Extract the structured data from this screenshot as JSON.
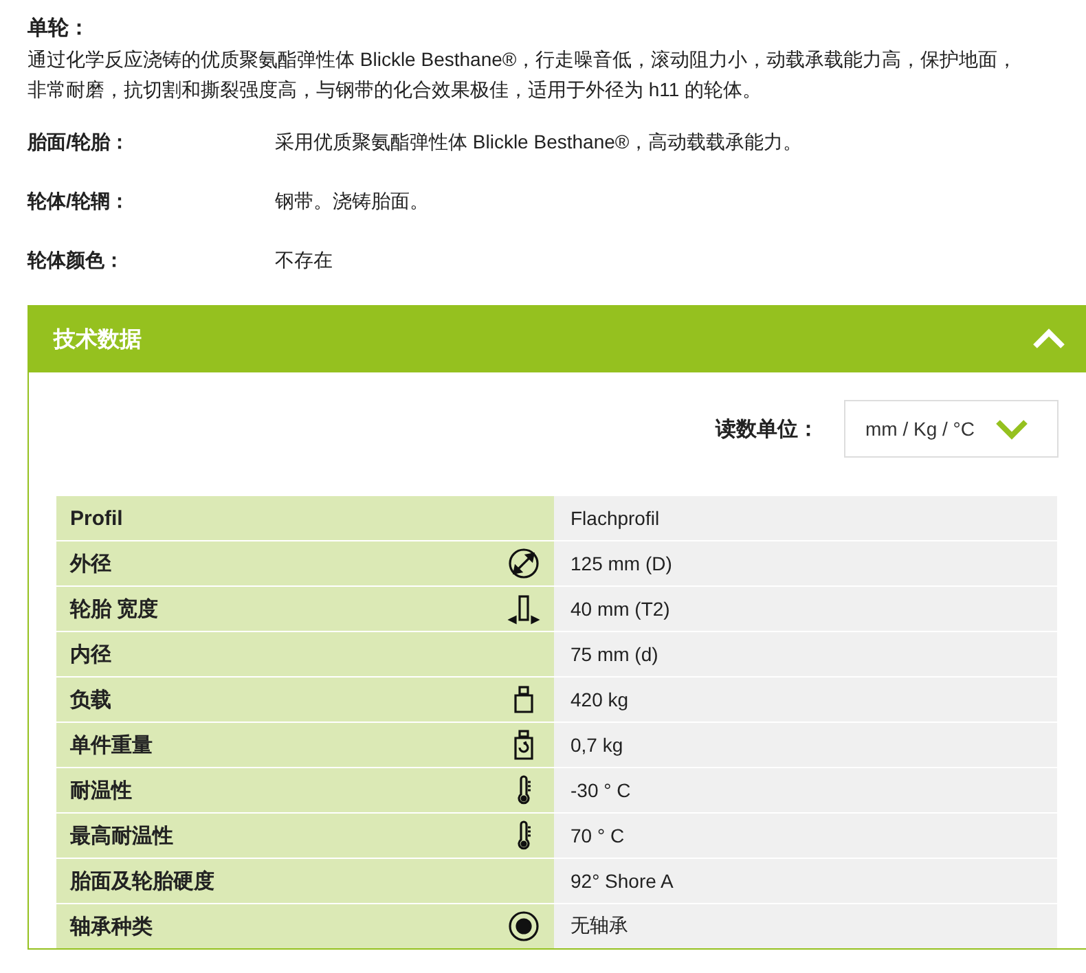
{
  "intro": {
    "title": "单轮：",
    "text": "通过化学反应浇铸的优质聚氨酯弹性体 Blickle Besthane®，行走噪音低，滚动阻力小，动载承载能力高，保护地面，非常耐磨，抗切割和撕裂强度高，与钢带的化合效果极佳，适用于外径为 h11 的轮体。"
  },
  "properties": [
    {
      "label": "胎面/轮胎：",
      "value": "采用优质聚氨酯弹性体 Blickle Besthane®，高动载载承能力。"
    },
    {
      "label": "轮体/轮辋：",
      "value": "钢带。浇铸胎面。"
    },
    {
      "label": "轮体颜色：",
      "value": "不存在"
    }
  ],
  "panel": {
    "title": "技术数据",
    "expanded": true,
    "unit_label": "读数单位：",
    "unit_value": "mm / Kg / °C",
    "rows": [
      {
        "label": "Profil",
        "kind": "none",
        "value": "Flachprofil"
      },
      {
        "label": "外径",
        "kind": "diameter",
        "value": "125 mm (D)"
      },
      {
        "label": "轮胎 宽度",
        "kind": "width",
        "value": "40 mm (T2)"
      },
      {
        "label": "内径",
        "kind": "none",
        "value": "75 mm (d)"
      },
      {
        "label": "负载",
        "kind": "weight",
        "value": "420 kg"
      },
      {
        "label": "单件重量",
        "kind": "unit-weight",
        "value": "0,7 kg"
      },
      {
        "label": "耐温性",
        "kind": "thermometer",
        "value": "-30 ° C"
      },
      {
        "label": "最高耐温性",
        "kind": "thermometer",
        "value": "70 ° C"
      },
      {
        "label": "胎面及轮胎硬度",
        "kind": "none",
        "value": "92° Shore A"
      },
      {
        "label": "轴承种类",
        "kind": "bearing",
        "value": "无轴承"
      }
    ]
  }
}
